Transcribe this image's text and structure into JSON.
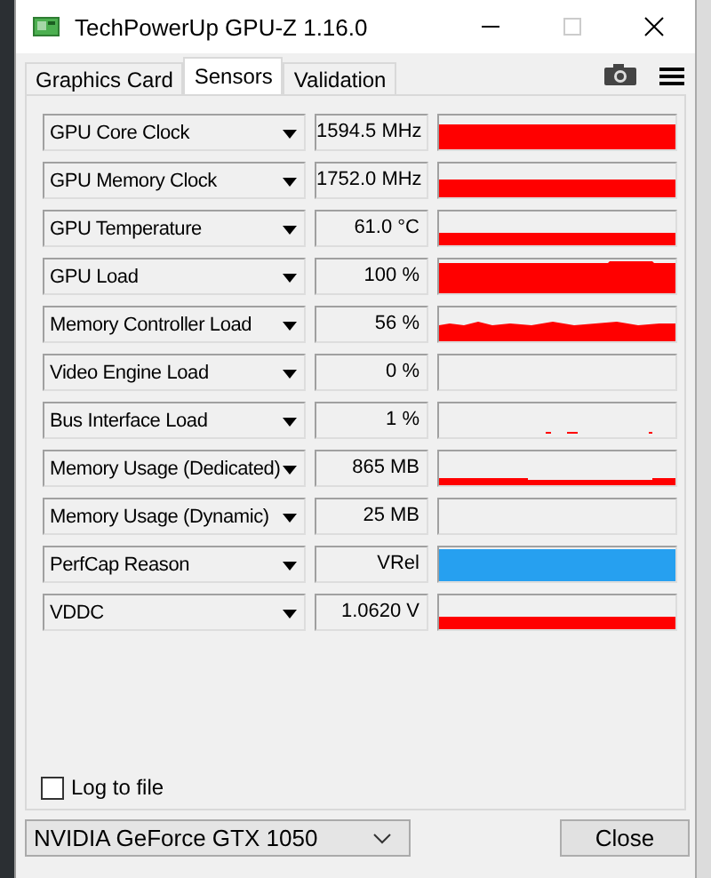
{
  "window": {
    "title": "TechPowerUp GPU-Z 1.16.0"
  },
  "tabs": [
    {
      "label": "Graphics Card",
      "selected": false
    },
    {
      "label": "Sensors",
      "selected": true
    },
    {
      "label": "Validation",
      "selected": false
    }
  ],
  "sensors": [
    {
      "name": "GPU Core Clock",
      "value": "1594.5 MHz",
      "color": "#ff0000"
    },
    {
      "name": "GPU Memory Clock",
      "value": "1752.0 MHz",
      "color": "#ff0000"
    },
    {
      "name": "GPU Temperature",
      "value": "61.0 °C",
      "color": "#ff0000"
    },
    {
      "name": "GPU Load",
      "value": "100 %",
      "color": "#ff0000"
    },
    {
      "name": "Memory Controller Load",
      "value": "56 %",
      "color": "#ff0000"
    },
    {
      "name": "Video Engine Load",
      "value": "0 %"
    },
    {
      "name": "Bus Interface Load",
      "value": "1 %",
      "color": "#ff0000"
    },
    {
      "name": "Memory Usage (Dedicated)",
      "value": "865 MB",
      "color": "#ff0000"
    },
    {
      "name": "Memory Usage (Dynamic)",
      "value": "25 MB"
    },
    {
      "name": "PerfCap Reason",
      "value": "VRel",
      "color": "#26a0f0"
    },
    {
      "name": "VDDC",
      "value": "1.0620 V",
      "color": "#ff0000"
    }
  ],
  "log_to_file": {
    "label": "Log to file",
    "checked": false
  },
  "gpu_select": {
    "value": "NVIDIA GeForce GTX 1050"
  },
  "close_button": "Close"
}
